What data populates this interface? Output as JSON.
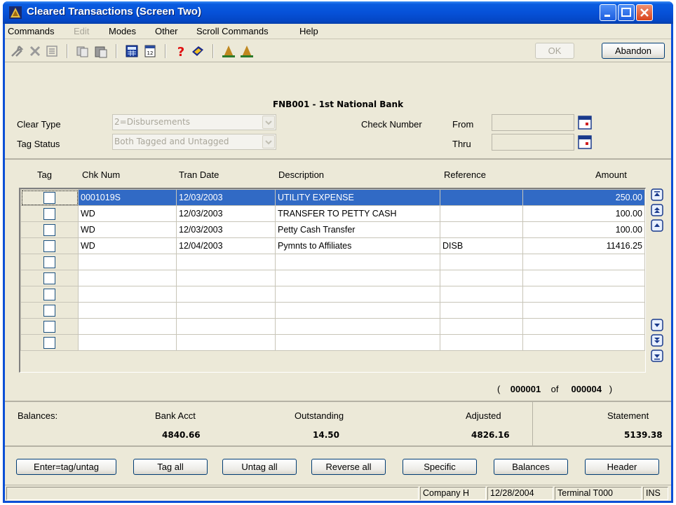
{
  "window": {
    "title": "Cleared Transactions (Screen Two)"
  },
  "menu": [
    "Commands",
    "Edit",
    "Modes",
    "Other",
    "Scroll Commands",
    "Help"
  ],
  "toolbar": {
    "ok_label": "OK",
    "abandon_label": "Abandon"
  },
  "header": {
    "bank": "FNB001 - 1st National Bank",
    "clear_type_label": "Clear Type",
    "clear_type_value": "2=Disbursements",
    "tag_status_label": "Tag Status",
    "tag_status_value": "Both Tagged and Untagged",
    "check_number_label": "Check Number",
    "from_label": "From",
    "thru_label": "Thru"
  },
  "grid": {
    "columns": [
      "Tag",
      "Chk Num",
      "Tran Date",
      "Description",
      "Reference",
      "Amount"
    ],
    "rows": [
      {
        "chk": "0001019S",
        "date": "12/03/2003",
        "desc": "UTILITY EXPENSE",
        "ref": "",
        "amount": "250.00"
      },
      {
        "chk": "WD",
        "date": "12/03/2003",
        "desc": "TRANSFER TO PETTY CASH",
        "ref": "",
        "amount": "100.00"
      },
      {
        "chk": "WD",
        "date": "12/03/2003",
        "desc": "Petty Cash Transfer",
        "ref": "",
        "amount": "100.00"
      },
      {
        "chk": "WD",
        "date": "12/04/2003",
        "desc": "Pymnts to Affiliates",
        "ref": "DISB",
        "amount": "11416.25"
      },
      {
        "chk": "",
        "date": "",
        "desc": "",
        "ref": "",
        "amount": ""
      },
      {
        "chk": "",
        "date": "",
        "desc": "",
        "ref": "",
        "amount": ""
      },
      {
        "chk": "",
        "date": "",
        "desc": "",
        "ref": "",
        "amount": ""
      },
      {
        "chk": "",
        "date": "",
        "desc": "",
        "ref": "",
        "amount": ""
      },
      {
        "chk": "",
        "date": "",
        "desc": "",
        "ref": "",
        "amount": ""
      },
      {
        "chk": "",
        "date": "",
        "desc": "",
        "ref": "",
        "amount": ""
      }
    ],
    "pager": {
      "open": "(",
      "current": "000001",
      "of": "of",
      "total": "000004",
      "close": ")"
    }
  },
  "balances": {
    "label": "Balances:",
    "bank_acct_label": "Bank Acct",
    "bank_acct": "4840.66",
    "outstanding_label": "Outstanding",
    "outstanding": "14.50",
    "adjusted_label": "Adjusted",
    "adjusted": "4826.16",
    "statement_label": "Statement",
    "statement": "5139.38"
  },
  "actions": [
    "Enter=tag/untag",
    "Tag all",
    "Untag all",
    "Reverse all",
    "Specific",
    "Balances",
    "Header"
  ],
  "status": {
    "company": "Company H",
    "date": "12/28/2004",
    "terminal": "Terminal T000",
    "mode": "INS"
  },
  "colors": {
    "title_blue": "#0651d8",
    "selection": "#316ac5",
    "face": "#ece9d8"
  }
}
